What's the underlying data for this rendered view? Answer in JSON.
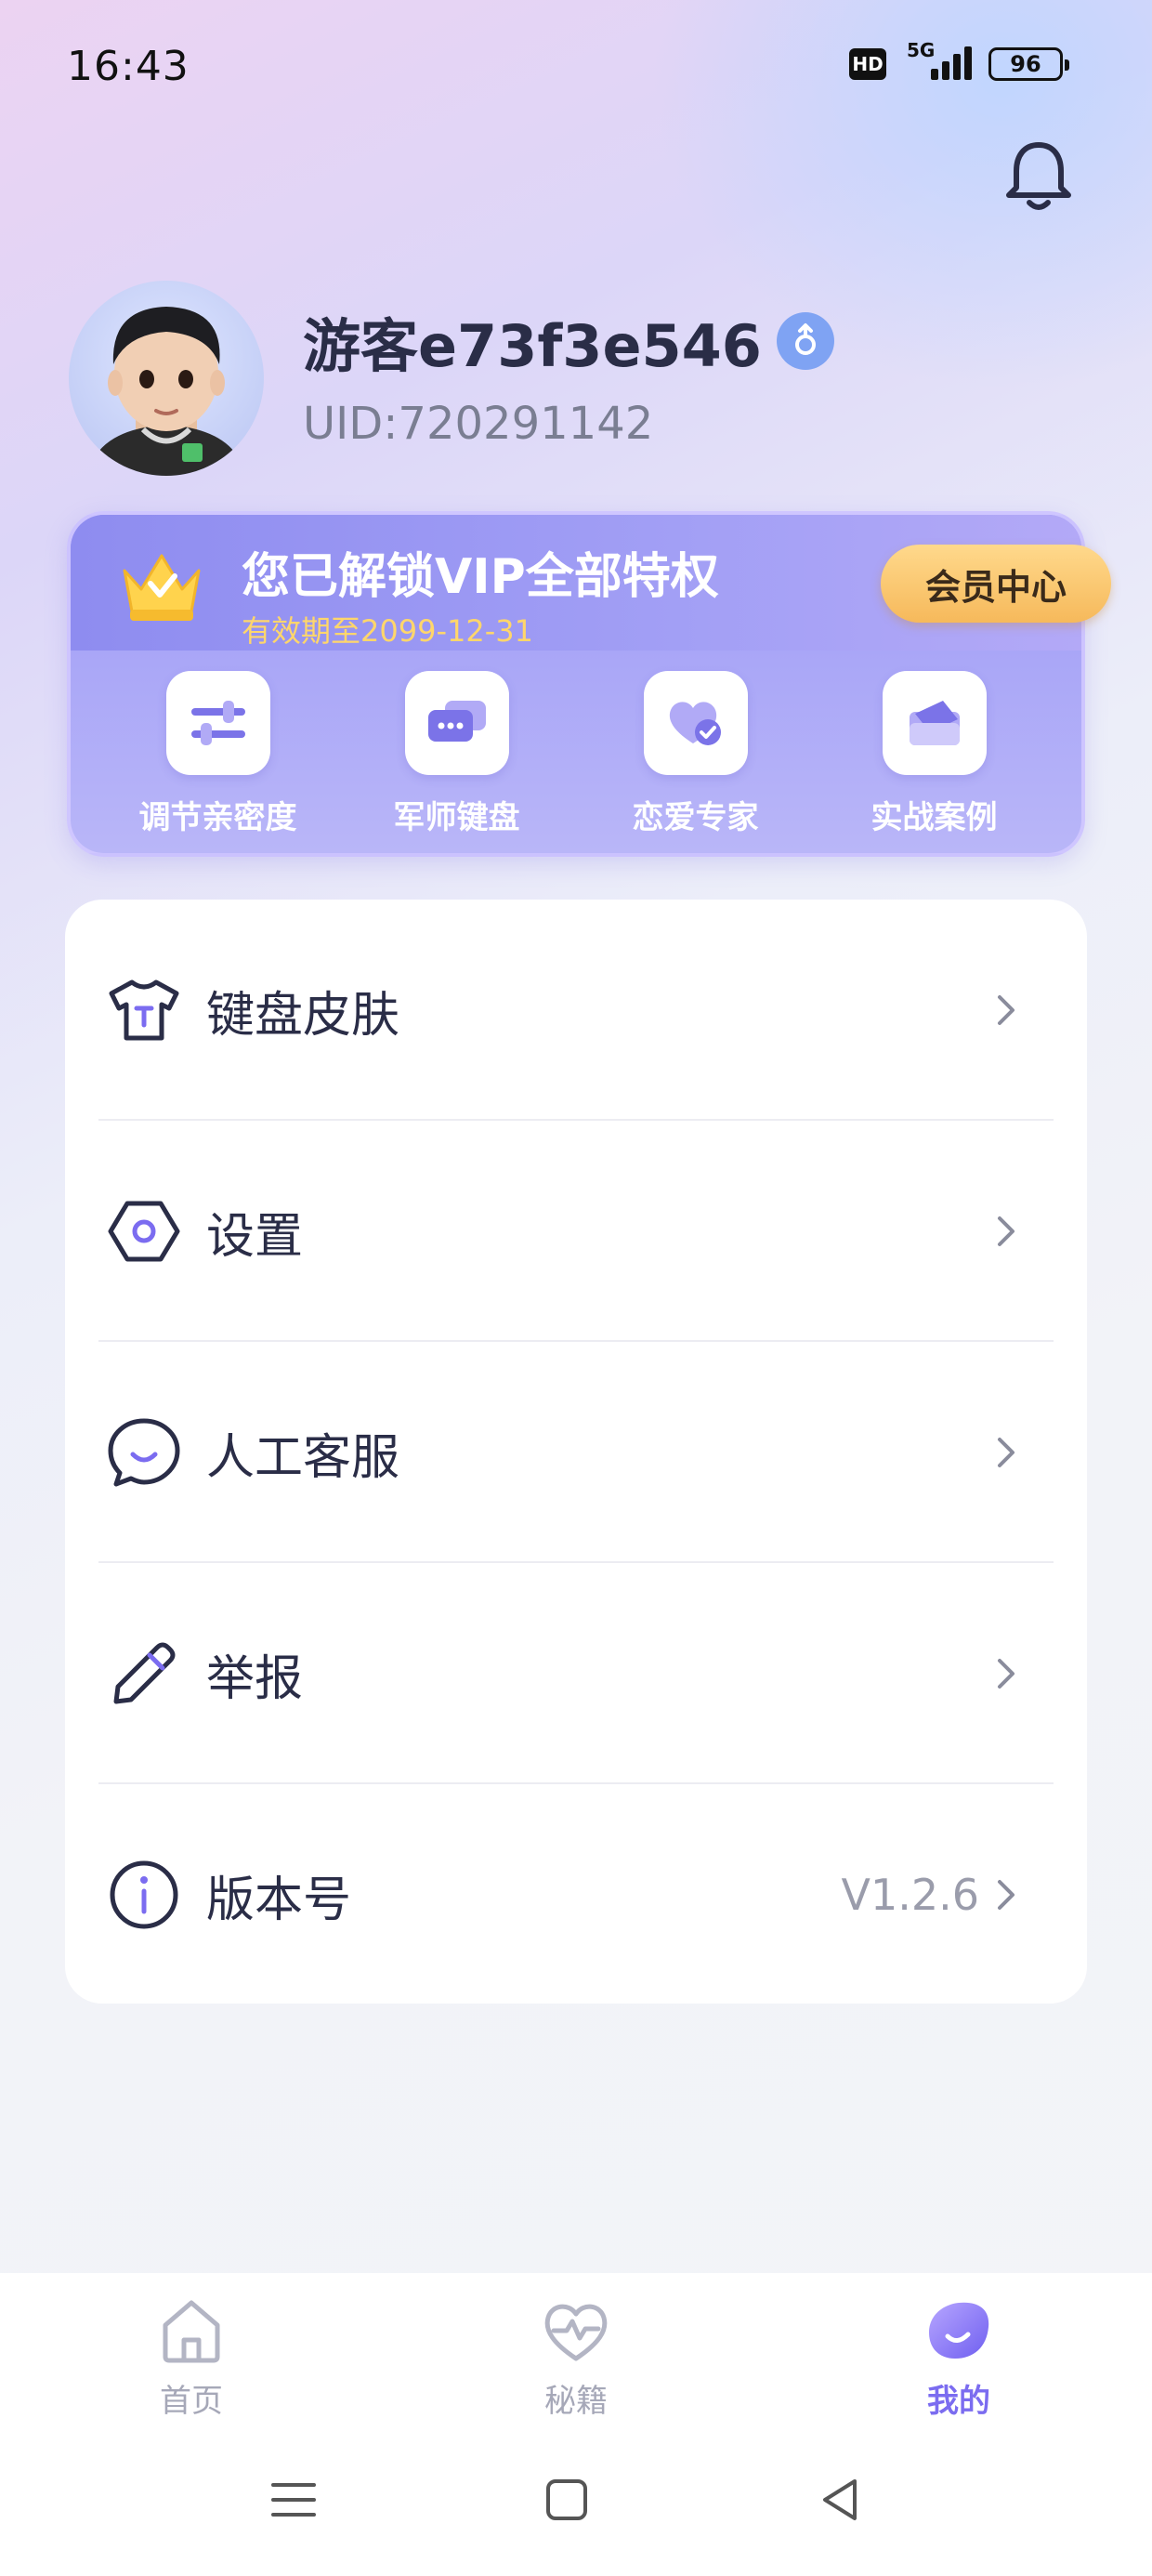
{
  "status_bar": {
    "time": "16:43",
    "hd": "HD",
    "network": "5G",
    "battery": "96"
  },
  "header": {
    "notification_icon": "bell-icon"
  },
  "profile": {
    "name": "游客e73f3e546",
    "gender_icon": "male-icon",
    "uid": "UID:720291142"
  },
  "vip": {
    "title": "您已解锁VIP全部特权",
    "expire": "有效期至2099-12-31",
    "member_center": "会员中心",
    "features": [
      {
        "label": "调节亲密度",
        "icon": "sliders-icon"
      },
      {
        "label": "军师键盘",
        "icon": "keyboard-chat-icon"
      },
      {
        "label": "恋爱专家",
        "icon": "heart-check-icon"
      },
      {
        "label": "实战案例",
        "icon": "card-folder-icon"
      }
    ]
  },
  "menu": {
    "items": [
      {
        "label": "键盘皮肤",
        "icon": "tshirt-icon",
        "value": ""
      },
      {
        "label": "设置",
        "icon": "hexagon-settings-icon",
        "value": ""
      },
      {
        "label": "人工客服",
        "icon": "chat-smile-icon",
        "value": ""
      },
      {
        "label": "举报",
        "icon": "pencil-icon",
        "value": ""
      },
      {
        "label": "版本号",
        "icon": "info-icon",
        "value": "V1.2.6"
      }
    ]
  },
  "bottom_nav": {
    "tabs": [
      {
        "label": "首页",
        "icon": "home-icon",
        "active": false
      },
      {
        "label": "秘籍",
        "icon": "heart-pulse-icon",
        "active": false
      },
      {
        "label": "我的",
        "icon": "profile-blob-icon",
        "active": true
      }
    ]
  },
  "colors": {
    "accent": "#7b6cf0",
    "vip_gold": "#ffd66b",
    "member_button": "#f6b95b",
    "text_primary": "#2a2d47",
    "text_secondary": "#7a7e92"
  }
}
